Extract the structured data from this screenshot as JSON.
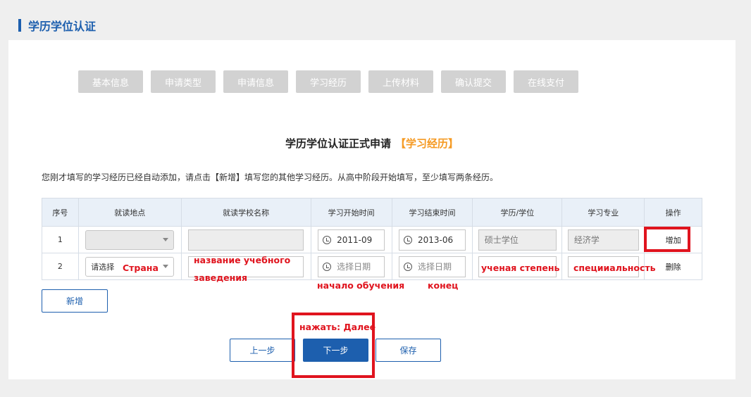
{
  "header": {
    "title": "学历学位认证"
  },
  "steps": [
    "基本信息",
    "申请类型",
    "申请信息",
    "学习经历",
    "上传材料",
    "确认提交",
    "在线支付"
  ],
  "form": {
    "title": "学历学位认证正式申请",
    "title_highlight": "【学习经历】"
  },
  "intro": "您刚才填写的学习经历已经自动添加，请点击【新增】填写您的其他学习经历。从高中阶段开始填写，至少填写两条经历。",
  "table": {
    "columns": [
      "序号",
      "就读地点",
      "就读学校名称",
      "学习开始时间",
      "学习结束时间",
      "学历/学位",
      "学习专业",
      "操作"
    ],
    "rows": [
      {
        "no": "1",
        "location": "",
        "school": "",
        "start": "2011-09",
        "end": "2013-06",
        "degree": "硕士学位",
        "major": "经济学",
        "action": "增加"
      },
      {
        "no": "2",
        "location": "请选择",
        "school": "",
        "start_placeholder": "选择日期",
        "end_placeholder": "选择日期",
        "degree": "",
        "major": "",
        "action": "删除"
      }
    ]
  },
  "buttons": {
    "add": "新增",
    "prev": "上一步",
    "next": "下一步",
    "save": "保存"
  },
  "annotations": {
    "country": "Страна",
    "school_name_1": "название учебного",
    "school_name_2": "заведения",
    "start": "начало обучения",
    "end": "конец",
    "degree": "ученая степень",
    "major": "специиальность",
    "press_next": "нажать: Далее"
  },
  "colors": {
    "brand": "#1d5fae",
    "highlight": "#f59a23",
    "annotation": "#e0141e",
    "step_inactive": "#d2d2d2"
  }
}
